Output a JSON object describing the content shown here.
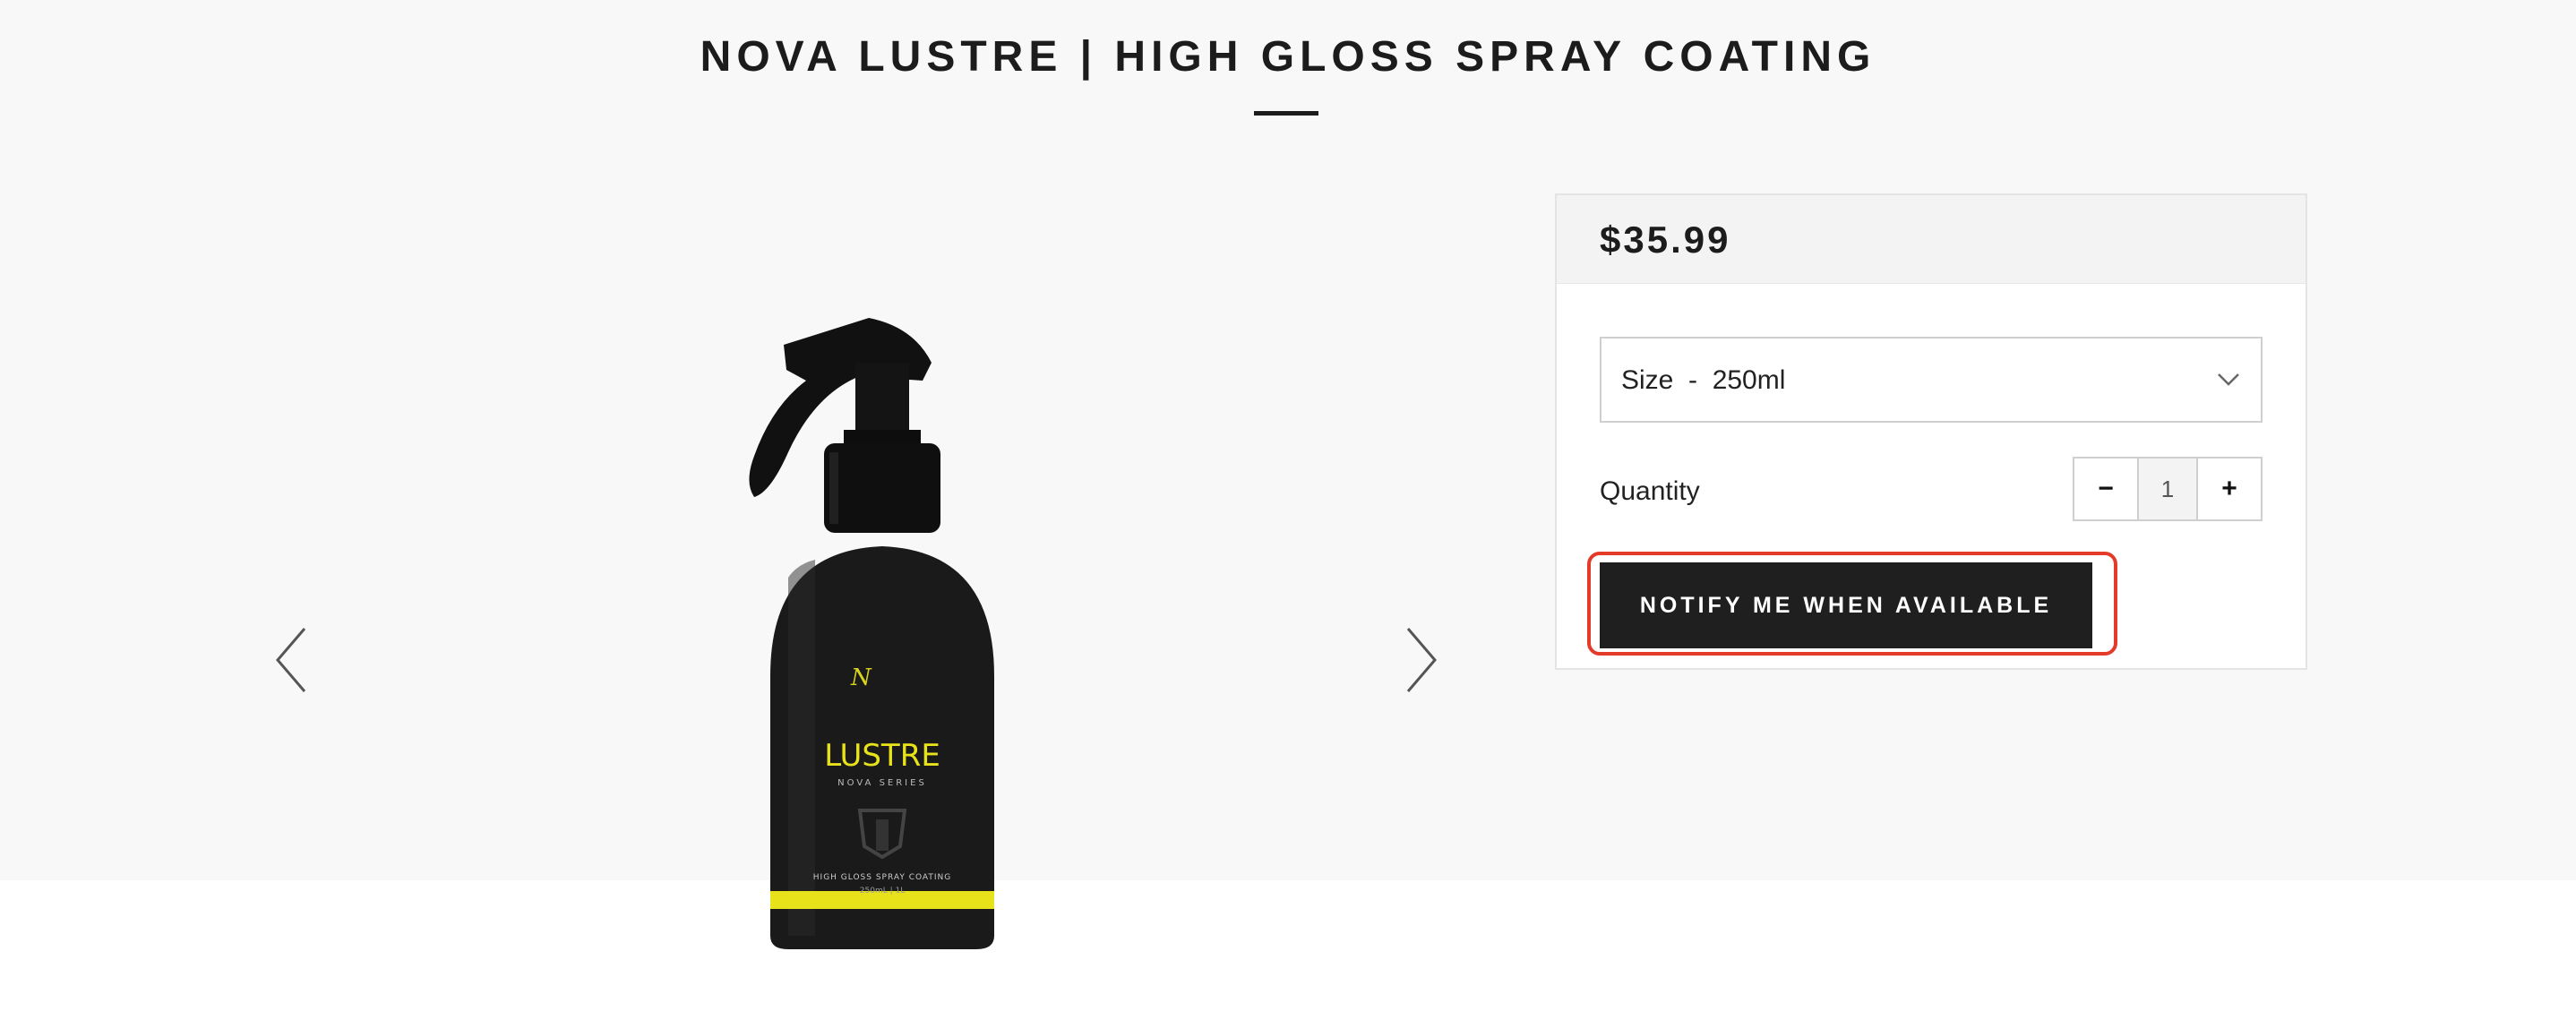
{
  "product": {
    "title": "NOVA LUSTRE | HIGH GLOSS SPRAY COATING",
    "price": "$35.99",
    "image": {
      "logo_text": "LUSTRE",
      "series_text": "NOVA SERIES",
      "description_text": "HIGH GLOSS SPRAY COATING",
      "volume_text": "250mL | 1L",
      "accent_color": "#e8e21a"
    }
  },
  "gallery": {
    "prev_icon": "chevron-left-icon",
    "next_icon": "chevron-right-icon"
  },
  "options": {
    "size_label": "Size  -  250ml",
    "size_icon": "chevron-down-icon"
  },
  "quantity": {
    "label": "Quantity",
    "value": "1",
    "decrement": "−",
    "increment": "+"
  },
  "actions": {
    "notify_label": "NOTIFY ME WHEN AVAILABLE",
    "highlight_color": "#e33a2a"
  }
}
